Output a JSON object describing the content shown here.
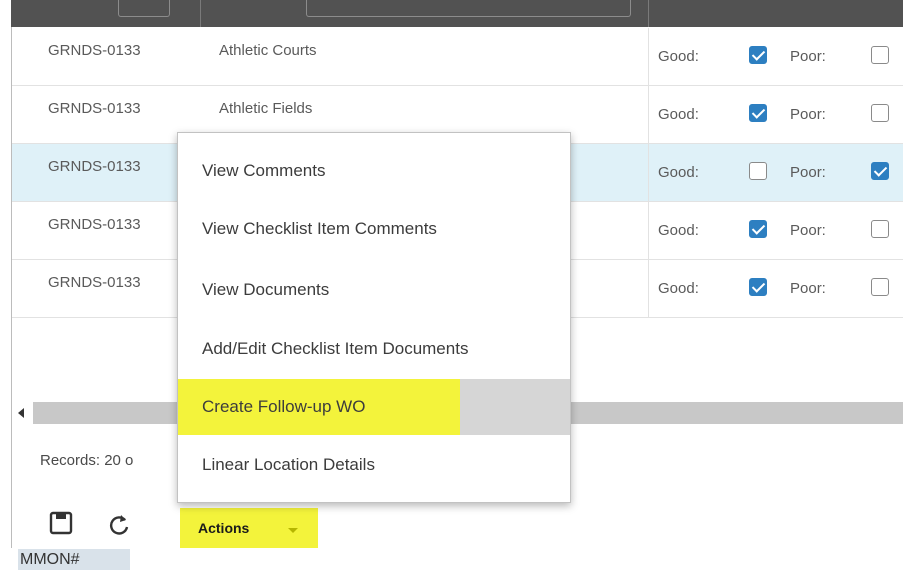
{
  "table": {
    "rows": [
      {
        "code": "GRNDS-0133",
        "description": "Athletic Courts",
        "good": true,
        "poor": false,
        "selected": false
      },
      {
        "code": "GRNDS-0133",
        "description": "Athletic Fields",
        "good": true,
        "poor": false,
        "selected": false
      },
      {
        "code": "GRNDS-0133",
        "description": "",
        "good": false,
        "poor": true,
        "selected": true
      },
      {
        "code": "GRNDS-0133",
        "description": "",
        "good": true,
        "poor": false,
        "selected": false
      },
      {
        "code": "GRNDS-0133",
        "description": "",
        "good": true,
        "poor": false,
        "selected": false
      }
    ],
    "good_label": "Good:",
    "poor_label": "Poor:"
  },
  "footer": {
    "records": "Records: 20 o"
  },
  "actions": {
    "label": "Actions"
  },
  "context_menu": {
    "items": [
      "View Comments",
      "View Checklist Item Comments",
      "View Documents",
      "Add/Edit Checklist Item Documents",
      "Create Follow-up WO",
      "Linear Location Details"
    ],
    "highlighted_index": 4
  },
  "bottom_tab": {
    "label": "MMON#"
  },
  "colors": {
    "header": "#525252",
    "selected_row": "#dff1f8",
    "checkbox_checked": "#2d7fc1",
    "highlight": "#f3f33b"
  }
}
